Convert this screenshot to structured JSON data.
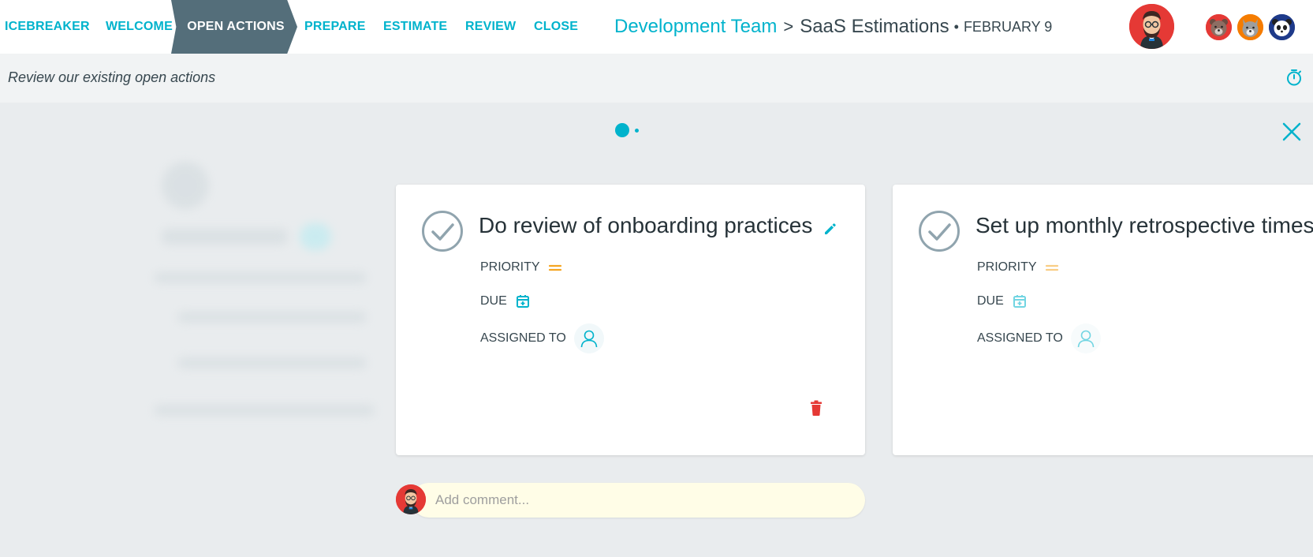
{
  "nav": {
    "steps": [
      {
        "label": "ICEBREAKER"
      },
      {
        "label": "WELCOME"
      },
      {
        "label": "OPEN ACTIONS"
      },
      {
        "label": "PREPARE"
      },
      {
        "label": "ESTIMATE"
      },
      {
        "label": "REVIEW"
      },
      {
        "label": "CLOSE"
      }
    ],
    "active_step": "OPEN ACTIONS"
  },
  "breadcrumb": {
    "team": "Development Team",
    "separator": ">",
    "session": "SaaS Estimations",
    "dot": "•",
    "date": "FEBRUARY 9"
  },
  "participants": [
    {
      "icon": "bear-avatar-icon",
      "color": "#e53935"
    },
    {
      "icon": "wolf-avatar-icon",
      "color": "#f57c00"
    },
    {
      "icon": "panda-avatar-icon",
      "color": "#1e3a8a"
    }
  ],
  "subheader": {
    "text": "Review our existing open actions",
    "timer_icon": "stopwatch-icon"
  },
  "carousel": {
    "current_page": 1,
    "total_pages": 2
  },
  "actions": [
    {
      "title": "Do review of onboarding practices",
      "priority_label": "PRIORITY",
      "due_label": "DUE",
      "assigned_label": "ASSIGNED TO"
    },
    {
      "title": "Set up monthly retrospective times",
      "priority_label": "PRIORITY",
      "due_label": "DUE",
      "assigned_label": "ASSIGNED TO"
    }
  ],
  "comment": {
    "placeholder": "Add comment...",
    "value": ""
  },
  "colors": {
    "accent": "#00b3cc",
    "active_step_bg": "#546e7a",
    "priority": "#f5a623",
    "delete": "#e53935",
    "comment_bg": "#fffde7"
  }
}
